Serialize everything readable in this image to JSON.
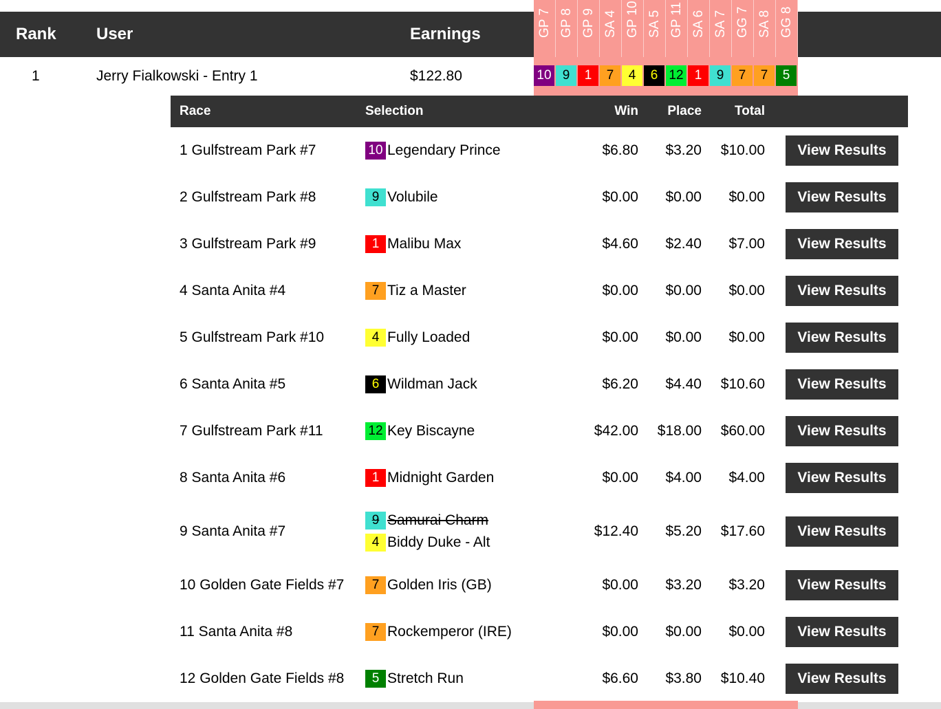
{
  "header": {
    "rank": "Rank",
    "user": "User",
    "earnings": "Earnings",
    "races": [
      "GP 7",
      "GP 8",
      "GP 9",
      "SA 4",
      "GP 10",
      "SA 5",
      "GP 11",
      "SA 6",
      "SA 7",
      "GG 7",
      "SA 8",
      "GG 8"
    ]
  },
  "entry": {
    "rank": "1",
    "user": "Jerry Fialkowski - Entry 1",
    "earnings": "$122.80",
    "picks": [
      {
        "num": "10",
        "bg": "#800080",
        "fg": "#ffffff"
      },
      {
        "num": "9",
        "bg": "#40e0d0",
        "fg": "#000000"
      },
      {
        "num": "1",
        "bg": "#ff0000",
        "fg": "#ffffff"
      },
      {
        "num": "7",
        "bg": "#ffa020",
        "fg": "#000000"
      },
      {
        "num": "4",
        "bg": "#ffff33",
        "fg": "#000000"
      },
      {
        "num": "6",
        "bg": "#000000",
        "fg": "#ffff00"
      },
      {
        "num": "12",
        "bg": "#00ee33",
        "fg": "#000000"
      },
      {
        "num": "1",
        "bg": "#ff0000",
        "fg": "#ffffff"
      },
      {
        "num": "9",
        "bg": "#40e0d0",
        "fg": "#000000"
      },
      {
        "num": "7",
        "bg": "#ffa020",
        "fg": "#000000"
      },
      {
        "num": "7",
        "bg": "#ffa020",
        "fg": "#000000"
      },
      {
        "num": "5",
        "bg": "#008000",
        "fg": "#ffffff"
      }
    ]
  },
  "detail": {
    "headers": {
      "race": "Race",
      "selection": "Selection",
      "win": "Win",
      "place": "Place",
      "total": "Total"
    },
    "button_label": "View Results",
    "rows": [
      {
        "race": "1 Gulfstream Park #7",
        "selections": [
          {
            "num": "10",
            "name": "Legendary Prince",
            "bg": "#800080",
            "fg": "#ffffff",
            "scratched": false
          }
        ],
        "win": "$6.80",
        "place": "$3.20",
        "total": "$10.00"
      },
      {
        "race": "2 Gulfstream Park #8",
        "selections": [
          {
            "num": "9",
            "name": "Volubile",
            "bg": "#40e0d0",
            "fg": "#000000",
            "scratched": false
          }
        ],
        "win": "$0.00",
        "place": "$0.00",
        "total": "$0.00"
      },
      {
        "race": "3 Gulfstream Park #9",
        "selections": [
          {
            "num": "1",
            "name": "Malibu Max",
            "bg": "#ff0000",
            "fg": "#ffffff",
            "scratched": false
          }
        ],
        "win": "$4.60",
        "place": "$2.40",
        "total": "$7.00"
      },
      {
        "race": "4 Santa Anita #4",
        "selections": [
          {
            "num": "7",
            "name": "Tiz a Master",
            "bg": "#ffa020",
            "fg": "#000000",
            "scratched": false
          }
        ],
        "win": "$0.00",
        "place": "$0.00",
        "total": "$0.00"
      },
      {
        "race": "5 Gulfstream Park #10",
        "selections": [
          {
            "num": "4",
            "name": "Fully Loaded",
            "bg": "#ffff33",
            "fg": "#000000",
            "scratched": false
          }
        ],
        "win": "$0.00",
        "place": "$0.00",
        "total": "$0.00"
      },
      {
        "race": "6 Santa Anita #5",
        "selections": [
          {
            "num": "6",
            "name": "Wildman Jack",
            "bg": "#000000",
            "fg": "#ffff00",
            "scratched": false
          }
        ],
        "win": "$6.20",
        "place": "$4.40",
        "total": "$10.60"
      },
      {
        "race": "7 Gulfstream Park #11",
        "selections": [
          {
            "num": "12",
            "name": "Key Biscayne",
            "bg": "#00ee33",
            "fg": "#000000",
            "scratched": false
          }
        ],
        "win": "$42.00",
        "place": "$18.00",
        "total": "$60.00"
      },
      {
        "race": "8 Santa Anita #6",
        "selections": [
          {
            "num": "1",
            "name": "Midnight Garden",
            "bg": "#ff0000",
            "fg": "#ffffff",
            "scratched": false
          }
        ],
        "win": "$0.00",
        "place": "$4.00",
        "total": "$4.00"
      },
      {
        "race": "9 Santa Anita #7",
        "selections": [
          {
            "num": "9",
            "name": "Samurai Charm",
            "bg": "#40e0d0",
            "fg": "#000000",
            "scratched": true
          },
          {
            "num": "4",
            "name": "Biddy Duke - Alt",
            "bg": "#ffff33",
            "fg": "#000000",
            "scratched": false
          }
        ],
        "win": "$12.40",
        "place": "$5.20",
        "total": "$17.60"
      },
      {
        "race": "10 Golden Gate Fields #7",
        "selections": [
          {
            "num": "7",
            "name": "Golden Iris (GB)",
            "bg": "#ffa020",
            "fg": "#000000",
            "scratched": false
          }
        ],
        "win": "$0.00",
        "place": "$3.20",
        "total": "$3.20"
      },
      {
        "race": "11 Santa Anita #8",
        "selections": [
          {
            "num": "7",
            "name": "Rockemperor (IRE)",
            "bg": "#ffa020",
            "fg": "#000000",
            "scratched": false
          }
        ],
        "win": "$0.00",
        "place": "$0.00",
        "total": "$0.00"
      },
      {
        "race": "12 Golden Gate Fields #8",
        "selections": [
          {
            "num": "5",
            "name": "Stretch Run",
            "bg": "#008000",
            "fg": "#ffffff",
            "scratched": false
          }
        ],
        "win": "$6.60",
        "place": "$3.80",
        "total": "$10.40"
      }
    ]
  }
}
